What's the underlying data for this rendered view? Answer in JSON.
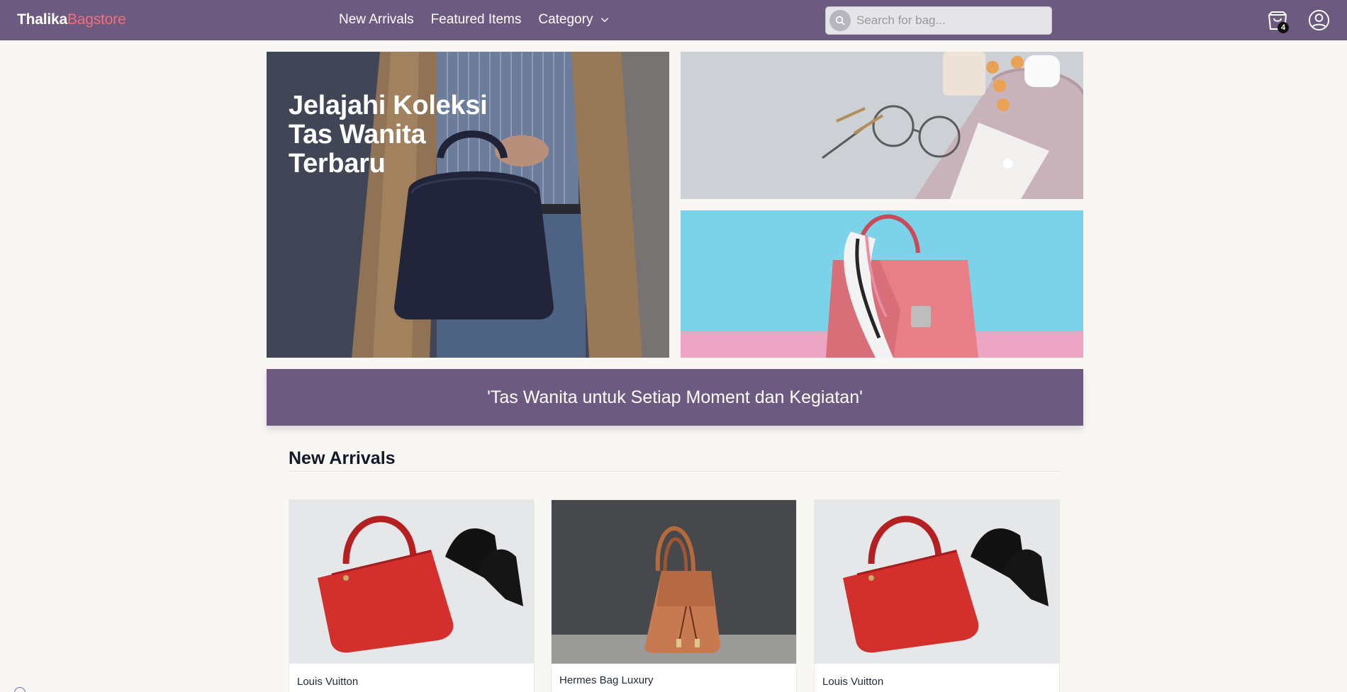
{
  "nav": {
    "brand_main": "Thalika",
    "brand_accent": "Bagstore",
    "links": [
      "New Arrivals",
      "Featured Items",
      "Category"
    ],
    "search_placeholder": "Search for bag...",
    "cart_count": "4",
    "icons": {
      "search": "search-icon",
      "chevron": "chevron-down-icon",
      "cart": "shopping-bag-icon",
      "user": "user-circle-icon"
    }
  },
  "hero": {
    "title_line1": "Jelajahi Koleksi",
    "title_line2": "Tas Wanita",
    "title_line3": "Terbaru"
  },
  "tagline": "'Tas Wanita untuk Setiap Moment dan Kegiatan'",
  "new_arrivals": {
    "title": "New Arrivals",
    "products": [
      {
        "name": "Louis Vuitton"
      },
      {
        "name": "Hermes Bag Luxury"
      },
      {
        "name": "Louis Vuitton"
      }
    ]
  },
  "colors": {
    "primary": "#6c5a80",
    "accent": "#f0707a",
    "background": "#f9f7f4"
  }
}
